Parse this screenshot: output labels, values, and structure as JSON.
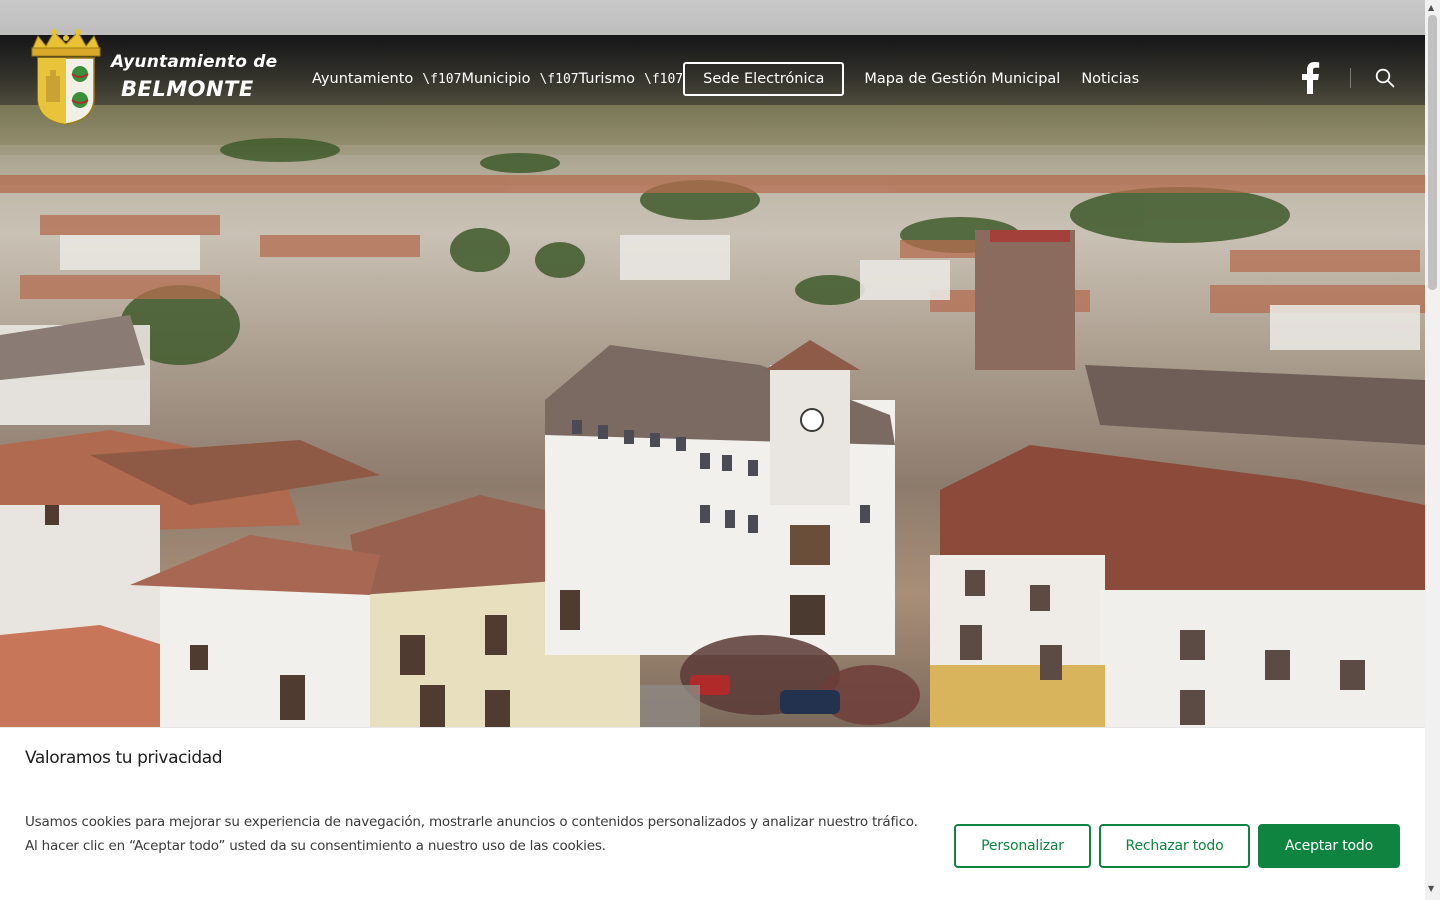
{
  "header": {
    "logo": {
      "line1": "Ayuntamiento de",
      "line2": "BELMONTE"
    },
    "nav": [
      {
        "label": "Ayuntamiento",
        "caret": "\\f107"
      },
      {
        "label": "Municipio",
        "caret": "\\f107"
      },
      {
        "label": "Turismo",
        "caret": "\\f107"
      }
    ],
    "sede_label": "Sede Electrónica",
    "mapa_label": "Mapa de Gestión Municipal",
    "noticias_label": "Noticias",
    "icons": {
      "social": "facebook-icon",
      "search": "search-icon"
    }
  },
  "hero": {
    "image": "aerial-view-of-town"
  },
  "cookie_banner": {
    "title": "Valoramos tu privacidad",
    "text": "Usamos cookies para mejorar su experiencia de navegación, mostrarle anuncios o contenidos personalizados y analizar nuestro tráfico. Al hacer clic en “Aceptar todo” usted da su consentimiento a nuestro uso de las cookies.",
    "buttons": {
      "customize": "Personalizar",
      "reject": "Rechazar todo",
      "accept": "Aceptar todo"
    }
  },
  "colors": {
    "accent": "#0f8441",
    "header_overlay": "#16161b"
  }
}
